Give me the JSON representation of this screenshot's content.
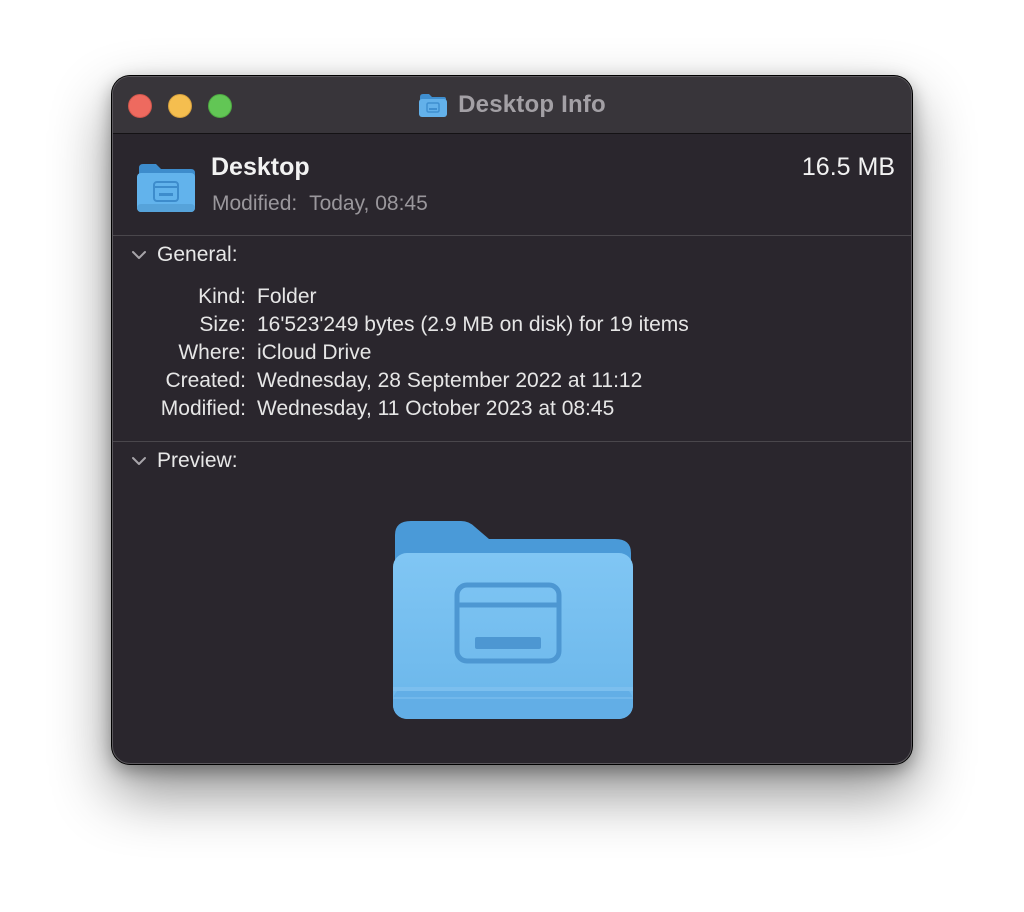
{
  "window": {
    "title": "Desktop Info",
    "title_icon": "folder-desktop-icon",
    "traffic_lights": [
      "close",
      "minimize",
      "zoom"
    ]
  },
  "header": {
    "name": "Desktop",
    "size": "16.5 MB",
    "modified_label": "Modified:",
    "modified_value": "Today, 08:45"
  },
  "general": {
    "heading": "General:",
    "rows": [
      {
        "label": "Kind:",
        "value": "Folder"
      },
      {
        "label": "Size:",
        "value": "16'523'249 bytes (2.9 MB on disk) for 19 items"
      },
      {
        "label": "Where:",
        "value": "iCloud Drive"
      },
      {
        "label": "Created:",
        "value": "Wednesday, 28 September 2022 at 11:12"
      },
      {
        "label": "Modified:",
        "value": "Wednesday, 11 October 2023 at 08:45"
      }
    ]
  },
  "preview": {
    "heading": "Preview:",
    "icon": "folder-desktop-icon"
  },
  "colors": {
    "window_bg": "#2a262d",
    "titlebar_bg": "#38353a",
    "folder_blue": "#6ab8ee",
    "close": "#ee6a5f",
    "minimize": "#f5be4f",
    "zoom": "#62c655"
  }
}
